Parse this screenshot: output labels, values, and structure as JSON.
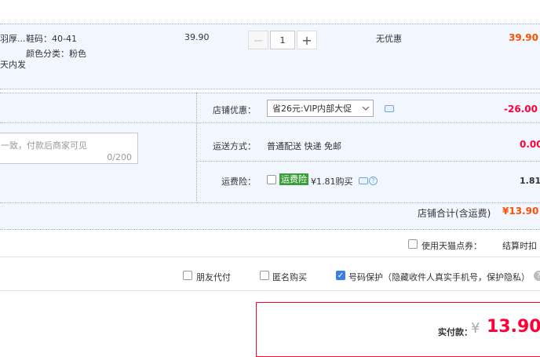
{
  "item": {
    "title_line1": "羽厚...",
    "title_line2": "天内发",
    "size_label": "鞋码：40-41",
    "color_label": "颜色分类：粉色",
    "unit_price": "39.90",
    "qty_minus": "−",
    "quantity": "1",
    "qty_plus": "+",
    "discount": "无优惠",
    "subtotal": "39.90"
  },
  "memo": {
    "placeholder": "一致，付款后商家可见",
    "counter": "0/200"
  },
  "shop": {
    "coupon_label": "店铺优惠：",
    "coupon_value": "省26元:VIP内部大促",
    "coupon_amount": "-26.00",
    "shipping_label": "运送方式：",
    "shipping_value": "普通配送 快递 免邮",
    "shipping_amount": "0.00",
    "insurance_label": "运费险：",
    "insurance_tag": "运费险",
    "insurance_price": "¥1.81购买",
    "insurance_amount": "1.81",
    "total_label": "店铺合计(含运费)",
    "total_value": "¥13.90"
  },
  "points": {
    "label": "使用天猫点券：",
    "note": "结算时扣"
  },
  "options": {
    "friend_pay": "朋友代付",
    "anonymous": "匿名购买",
    "privacy": "号码保护（隐藏收件人真实手机号，保护隐私）"
  },
  "payment": {
    "label": "实付款：",
    "currency": "¥",
    "amount": "13.90"
  },
  "colors": {
    "accent_red": "#ff0036",
    "orange": "#ff5000",
    "row_blue": "#f2f7ff",
    "checkbox_blue": "#3d7fe0"
  }
}
